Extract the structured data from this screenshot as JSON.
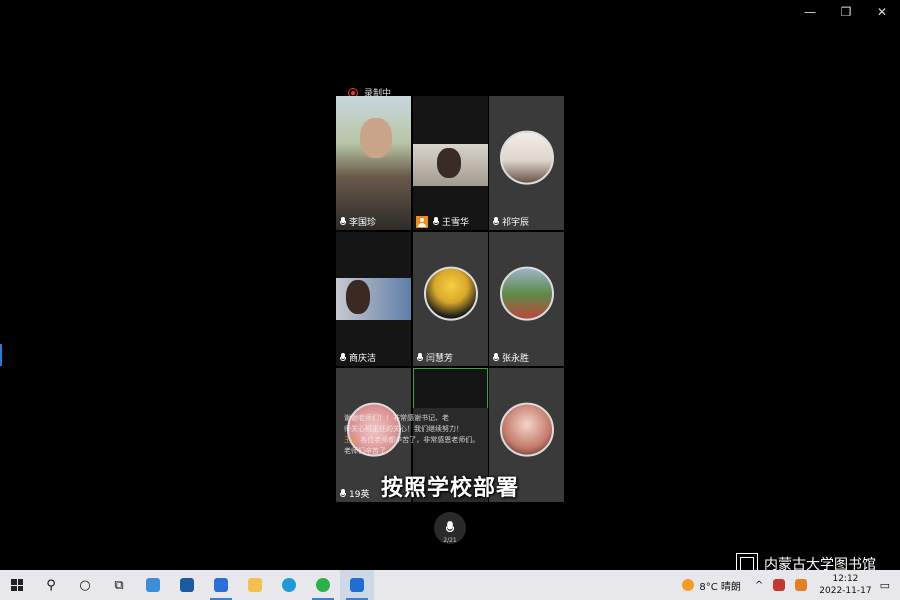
{
  "window": {
    "min": "—",
    "max": "❐",
    "close": "✕"
  },
  "recording": "录制中",
  "participants": [
    {
      "name": "李国珍",
      "kind": "video"
    },
    {
      "name": "王雪华",
      "kind": "video",
      "host": true
    },
    {
      "name": "祁宇辰",
      "kind": "avatar"
    },
    {
      "name": "商庆洁",
      "kind": "video"
    },
    {
      "name": "闫慧芳",
      "kind": "avatar"
    },
    {
      "name": "张永胜",
      "kind": "avatar"
    },
    {
      "name": "19英",
      "kind": "avatar"
    },
    {
      "name": "",
      "kind": "video"
    },
    {
      "name": "",
      "kind": "avatar"
    }
  ],
  "chat": {
    "line1": "谢谢老师们！！非常感谢书记、老",
    "line2": "师关心班主任的关心！我们继续努力！",
    "user2": "王丽",
    "line3": "各位老师都辛苦了，非常感恩老师们。",
    "line4": "老师们辛苦了"
  },
  "subtitle": "按照学校部署",
  "mic_count": "2/21",
  "watermark": "内蒙古大学图书馆",
  "taskbar": {
    "weather": "8°C  晴朗",
    "time": "12:12",
    "date": "2022-11-17",
    "tray_chevron": "^"
  }
}
